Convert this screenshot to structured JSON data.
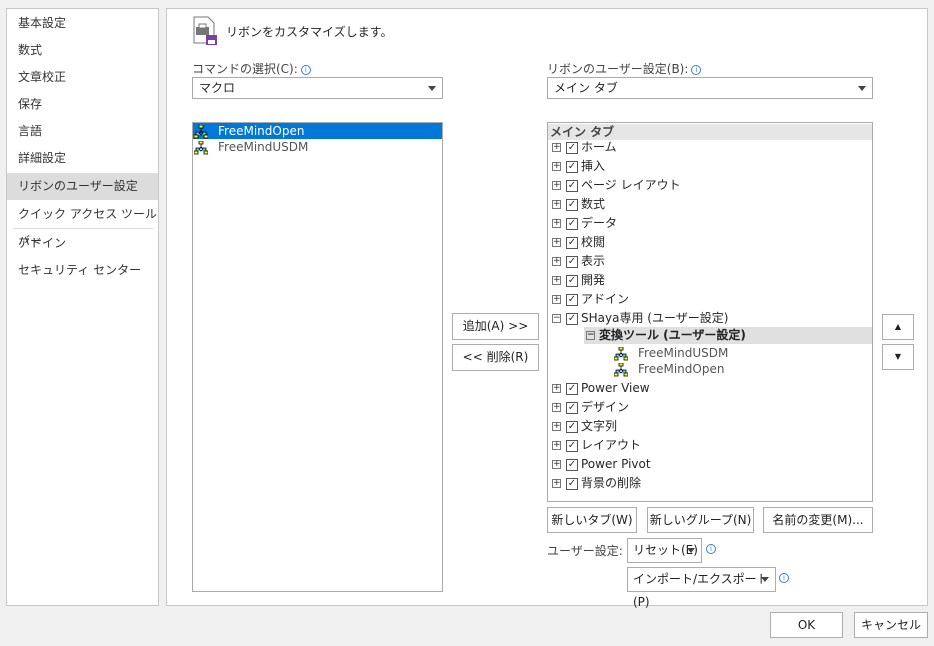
{
  "nav": {
    "items": [
      "基本設定",
      "数式",
      "文章校正",
      "保存",
      "言語",
      "詳細設定",
      "リボンのユーザー設定",
      "クイック アクセス ツール バー",
      "アドイン",
      "セキュリティ センター"
    ],
    "selected": "リボンのユーザー設定"
  },
  "header": {
    "title": "リボンをカスタマイズします。",
    "icon": "customize-ribbon-icon"
  },
  "commands": {
    "label": "コマンドの選択(C):",
    "select_value": "マクロ",
    "items": [
      "FreeMindOpen",
      "FreeMindUSDM"
    ],
    "selected": "FreeMindOpen"
  },
  "ribbon": {
    "label": "リボンのユーザー設定(B):",
    "select_value": "メイン タブ",
    "header": "メイン タブ",
    "tabs": [
      "ホーム",
      "挿入",
      "ページ レイアウト",
      "数式",
      "データ",
      "校閲",
      "表示",
      "開発",
      "アドイン"
    ],
    "custom_tab": "SHaya専用 (ユーザー設定)",
    "custom_group": "変換ツール (ユーザー設定)",
    "group_items": [
      "FreeMindUSDM",
      "FreeMindOpen"
    ],
    "tabs_after": [
      "Power View",
      "デザイン",
      "文字列",
      "レイアウト",
      "Power Pivot",
      "背景の削除"
    ]
  },
  "buttons": {
    "add": "追加(A) >>",
    "remove": "<< 削除(R)",
    "new_tab": "新しいタブ(W)",
    "new_group": "新しいグループ(N)",
    "rename": "名前の変更(M)...",
    "user_settings_label": "ユーザー設定:",
    "reset": "リセット(E)",
    "import_export": "インポート/エクスポート(P)",
    "ok": "OK",
    "cancel": "キャンセル",
    "move_up": "▲",
    "move_down": "▼"
  }
}
